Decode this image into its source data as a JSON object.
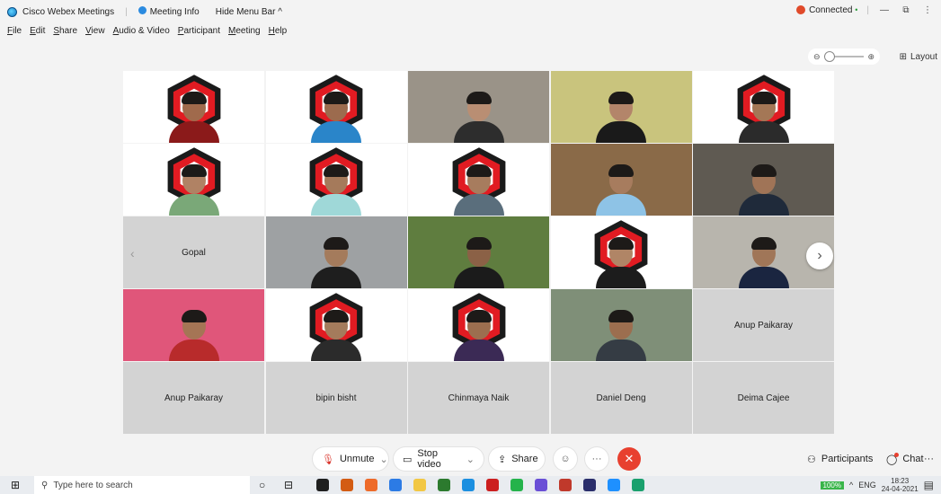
{
  "titlebar": {
    "app_name": "Cisco Webex Meetings",
    "meeting_info": "Meeting Info",
    "hide_menu": "Hide Menu Bar ^",
    "status": "Connected",
    "status_dot": "•",
    "separator": "|",
    "minimize": "—",
    "restore": "⧉",
    "more": "⋮"
  },
  "menu": [
    "File",
    "Edit",
    "Share",
    "View",
    "Audio & Video",
    "Participant",
    "Meeting",
    "Help"
  ],
  "view": {
    "zoom_out": "⊖",
    "zoom_in": "⊕",
    "layout_icon": "⊞",
    "layout_label": "Layout"
  },
  "tiles": [
    {
      "kind": "video",
      "logo": true,
      "skin": "#a06a4c",
      "shirt": "#8b1a1a",
      "bg": "#ffffff"
    },
    {
      "kind": "video",
      "logo": true,
      "skin": "#9c6b4e",
      "shirt": "#2a85c9",
      "bg": "#ffffff"
    },
    {
      "kind": "video",
      "logo": false,
      "skin": "#b98e73",
      "shirt": "#2d2d2d",
      "bg": "#9a9388"
    },
    {
      "kind": "video",
      "logo": false,
      "skin": "#b3856a",
      "shirt": "#1a1a1a",
      "bg": "#c9c47d"
    },
    {
      "kind": "video",
      "logo": true,
      "skin": "#a47756",
      "shirt": "#2b2b2b",
      "bg": "#ffffff"
    },
    {
      "kind": "video",
      "logo": true,
      "skin": "#b08264",
      "shirt": "#7aa878",
      "bg": "#ffffff"
    },
    {
      "kind": "video",
      "logo": true,
      "skin": "#a57a5b",
      "shirt": "#9fd8d8",
      "bg": "#ffffff"
    },
    {
      "kind": "video",
      "logo": true,
      "skin": "#a77c5e",
      "shirt": "#5a6e7c",
      "bg": "#ffffff"
    },
    {
      "kind": "video",
      "logo": false,
      "skin": "#a77c5e",
      "shirt": "#8ec3e6",
      "bg": "#8a6a48"
    },
    {
      "kind": "video",
      "logo": false,
      "skin": "#a07457",
      "shirt": "#1f2a3a",
      "bg": "#5f5a52"
    },
    {
      "kind": "name",
      "name": "Gopal",
      "prev": true
    },
    {
      "kind": "video",
      "logo": false,
      "skin": "#a47b5c",
      "shirt": "#1e1e1e",
      "bg": "#9ea1a3"
    },
    {
      "kind": "video",
      "logo": false,
      "skin": "#8b6146",
      "shirt": "#1b1b1b",
      "bg": "#5f7d3f"
    },
    {
      "kind": "video",
      "logo": true,
      "skin": "#b08566",
      "shirt": "#1c1c1c",
      "bg": "#ffffff"
    },
    {
      "kind": "video",
      "logo": false,
      "skin": "#a07658",
      "shirt": "#1a2540",
      "bg": "#b8b5ad"
    },
    {
      "kind": "video",
      "logo": false,
      "skin": "#a57555",
      "shirt": "#b82b2b",
      "bg": "#e0567a"
    },
    {
      "kind": "video",
      "logo": true,
      "skin": "#a47b5c",
      "shirt": "#2b2b2b",
      "bg": "#ffffff"
    },
    {
      "kind": "video",
      "logo": true,
      "skin": "#9c6e4f",
      "shirt": "#3b2a55",
      "bg": "#ffffff"
    },
    {
      "kind": "video",
      "logo": false,
      "skin": "#9c6e4f",
      "shirt": "#353c44",
      "bg": "#7f8f78"
    },
    {
      "kind": "name",
      "name": "Anup Paikaray"
    },
    {
      "kind": "name",
      "name": "Anup Paikaray"
    },
    {
      "kind": "name",
      "name": "bipin bisht"
    },
    {
      "kind": "name",
      "name": "Chinmaya Naik"
    },
    {
      "kind": "name",
      "name": "Daniel Deng"
    },
    {
      "kind": "name",
      "name": "Deima Cajee"
    }
  ],
  "nav": {
    "prev": "‹",
    "next": "›"
  },
  "controls": {
    "unmute": "Unmute",
    "mic_icon": "🎙",
    "caret": "⌄",
    "stop_video": "Stop video",
    "video_icon": "▭",
    "share": "Share",
    "share_icon": "⇪",
    "reactions": "☺",
    "more": "···",
    "end": "✕",
    "participants": "Participants",
    "participants_icon": "⚇",
    "chat": "Chat",
    "chat_icon": "◯"
  },
  "taskbar": {
    "start": "⊞",
    "search_icon": "⚲",
    "search_placeholder": "Type here to search",
    "cortana": "○",
    "taskview": "⊟",
    "apps": [
      "#1f1f1f",
      "#d35c13",
      "#ee6b2a",
      "#2c7be5",
      "#f2c744",
      "#2c7a2e",
      "#1b8fe0",
      "#cc1f1f",
      "#25b34b",
      "#6a4fd6",
      "#c0392b",
      "#2a2e6b",
      "#1e90ff",
      "#1aa06d"
    ],
    "battery": "100%",
    "up_arrow": "^",
    "lang": "ENG",
    "time": "18:23",
    "date": "24-04-2021",
    "notify": "▤"
  }
}
